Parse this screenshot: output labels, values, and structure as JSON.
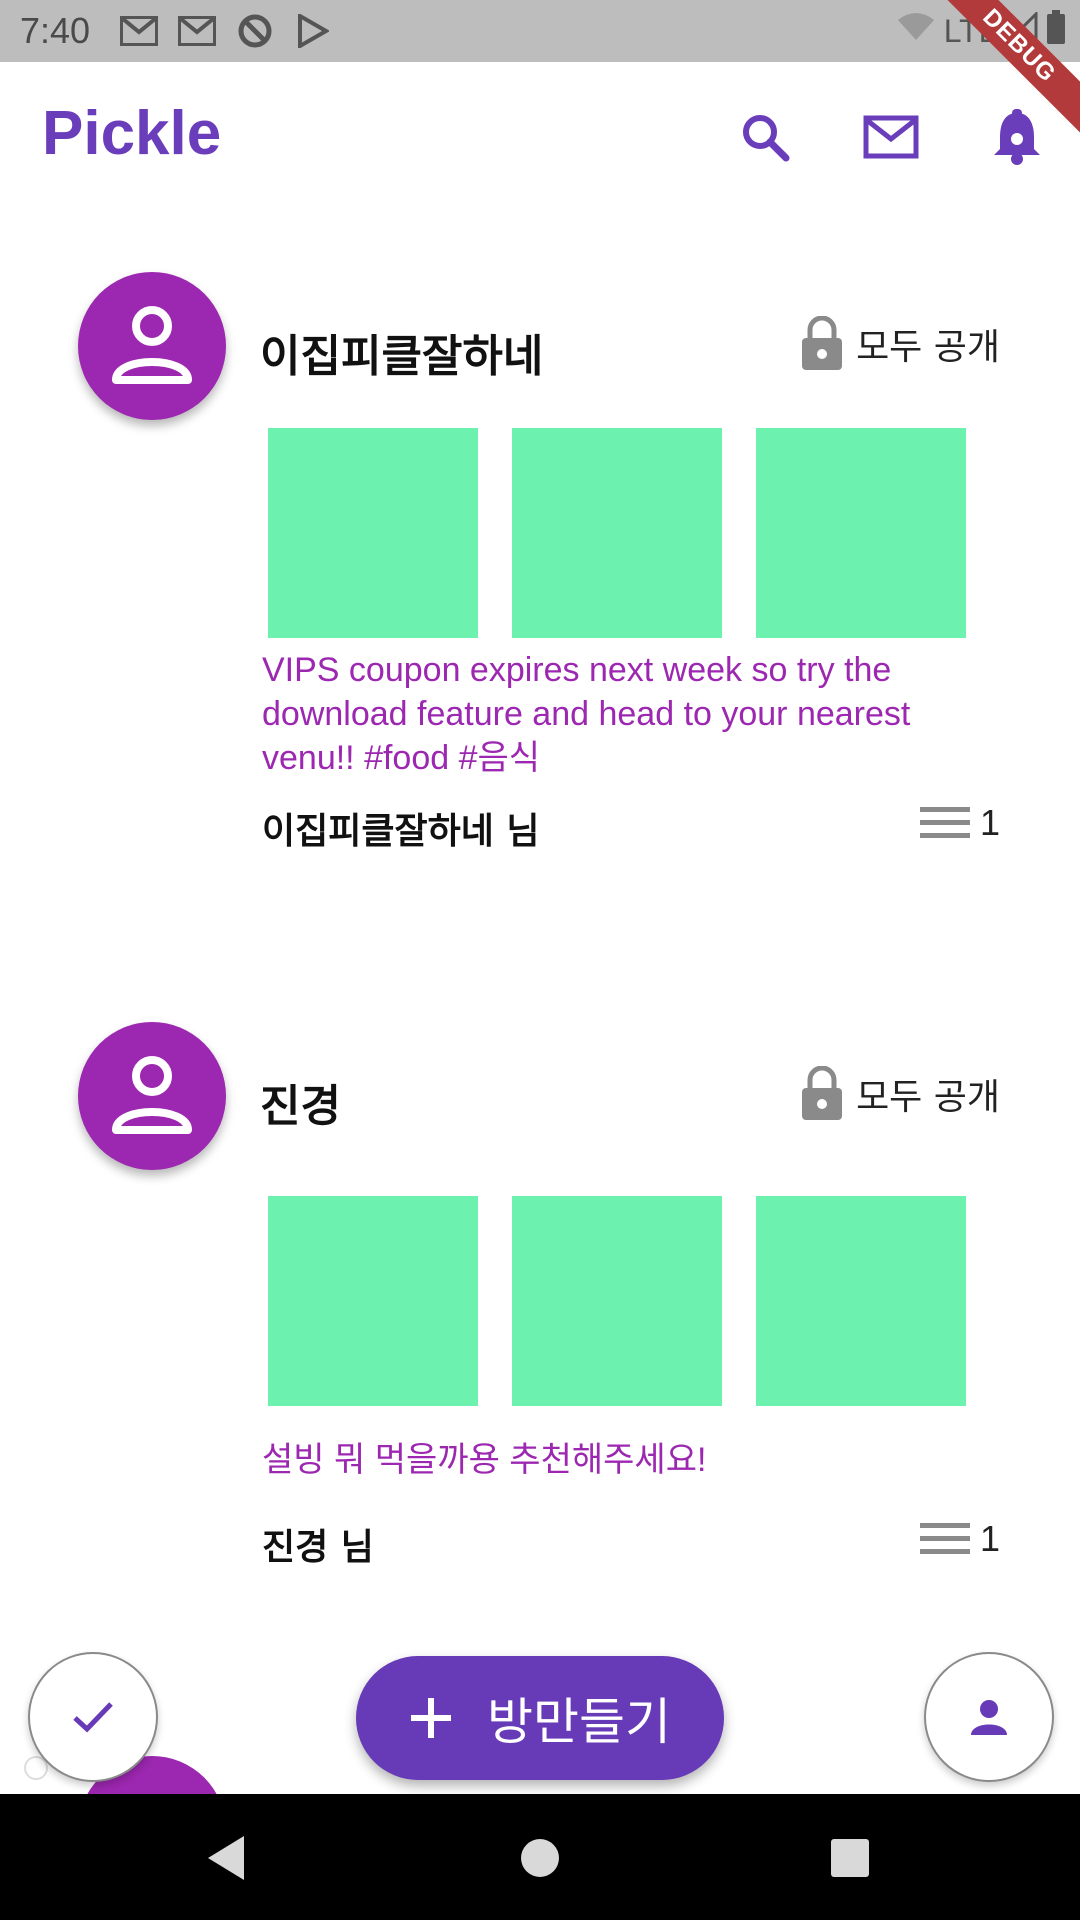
{
  "status": {
    "time": "7:40",
    "network": "LTE",
    "debug_label": "DEBUG"
  },
  "appbar": {
    "title": "Pickle",
    "icons": [
      "search-icon",
      "mail-icon",
      "notification-bell-icon"
    ]
  },
  "posts": [
    {
      "name": "이집피클잘하네",
      "privacy": "모두 공개",
      "text": "VIPS coupon expires next week so try the download feature and head to your nearest venu!! #food #음식",
      "author": "이집피클잘하네 님",
      "count": "1"
    },
    {
      "name": "진경",
      "privacy": "모두 공개",
      "text": "설빙 뭐 먹을까용 추천해주세요!",
      "author": "진경 님",
      "count": "1"
    }
  ],
  "actions": {
    "create_room_label": "방만들기",
    "create_room_icon": "plus-icon",
    "left_icon": "check-icon",
    "right_icon": "person-icon"
  },
  "colors": {
    "primary": "#673ab7",
    "avatar": "#9c27b0",
    "tile": "#6cf2ae",
    "post_text": "#9c27b0"
  }
}
